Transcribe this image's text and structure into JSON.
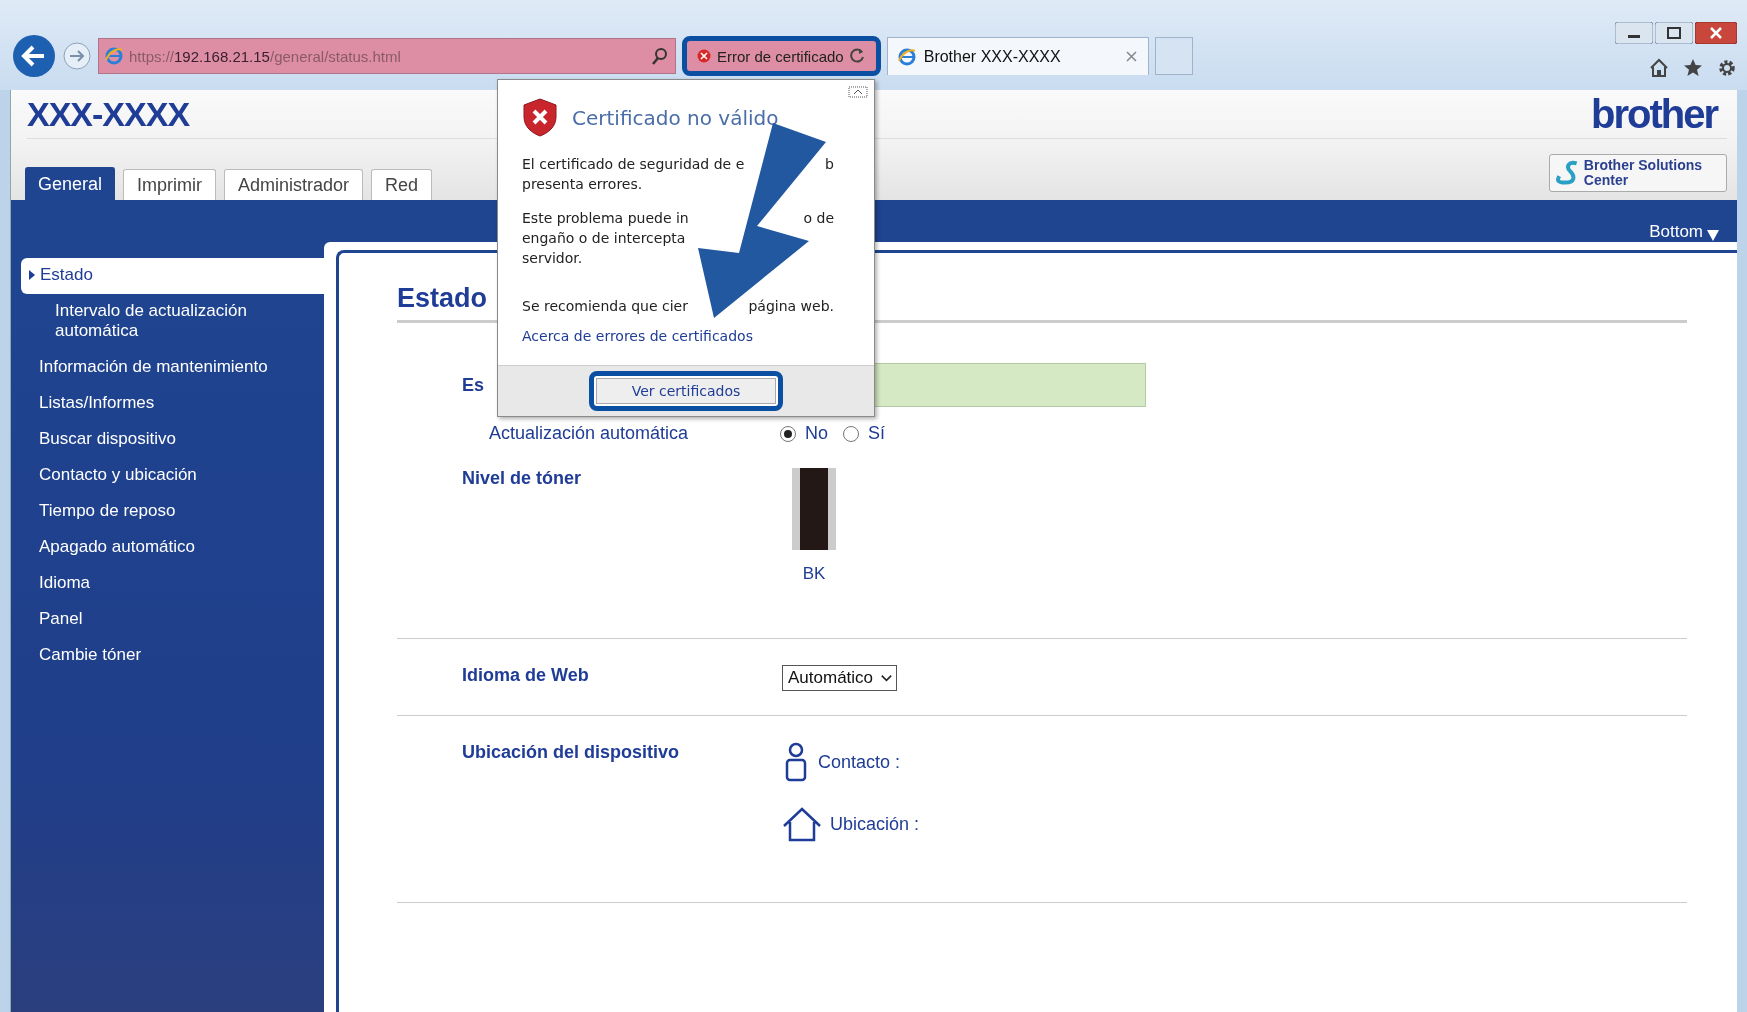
{
  "browser": {
    "url_scheme": "https://",
    "url_host": "192.168.21.15",
    "url_path": "/general/status.html",
    "cert_error": "Error de certificado",
    "tabs": [
      {
        "label": "Brother XXX-XXXX",
        "selected": true
      }
    ]
  },
  "header": {
    "model": "XXX-XXXX",
    "logo": "brother",
    "solutions": "Brother Solutions Center",
    "tabs": [
      {
        "label": "General",
        "selected": true
      },
      {
        "label": "Imprimir",
        "selected": false
      },
      {
        "label": "Administrador",
        "selected": false
      },
      {
        "label": "Red",
        "selected": false
      }
    ],
    "bottom_link": "Bottom"
  },
  "sidebar": {
    "items": [
      {
        "label": "Estado",
        "selected": true,
        "children": [
          {
            "label": "Intervalo de actualización automática",
            "selected": false
          }
        ]
      },
      {
        "label": "Información de mantenimiento",
        "selected": false
      },
      {
        "label": "Listas/Informes",
        "selected": false
      },
      {
        "label": "Buscar dispositivo",
        "selected": false
      },
      {
        "label": "Contacto y ubicación",
        "selected": false
      },
      {
        "label": "Tiempo de reposo",
        "selected": false
      },
      {
        "label": "Apagado automático",
        "selected": false
      },
      {
        "label": "Idioma",
        "selected": false
      },
      {
        "label": "Panel",
        "selected": false
      },
      {
        "label": "Cambie tóner",
        "selected": false
      }
    ]
  },
  "main": {
    "heading": "Estado",
    "status_label": "Es",
    "auto_update": {
      "label": "Actualización automática",
      "options": [
        {
          "label": "No",
          "selected": true
        },
        {
          "label": "Sí",
          "selected": false
        }
      ]
    },
    "toner": {
      "label": "Nivel de tóner",
      "color_name": "BK",
      "level": 1.0
    },
    "web_language": {
      "label": "Idioma de Web",
      "value": "Automático"
    },
    "location": {
      "label": "Ubicación del dispositivo",
      "contact": "Contacto :",
      "place": "Ubicación :"
    }
  },
  "popup": {
    "title": "Certificado no válido",
    "lines": [
      {
        "left": "El certificado de seguridad de e",
        "right": "b"
      },
      {
        "left": "presenta errores."
      },
      {
        "left": "Este problema puede in",
        "right": "o de"
      },
      {
        "left": "engaño o de intercepta"
      },
      {
        "left": "servidor."
      },
      {
        "left": "Se recomienda que cier",
        "right": "página web."
      }
    ],
    "link": "Acerca de errores de certificados",
    "button": "Ver certificados"
  }
}
